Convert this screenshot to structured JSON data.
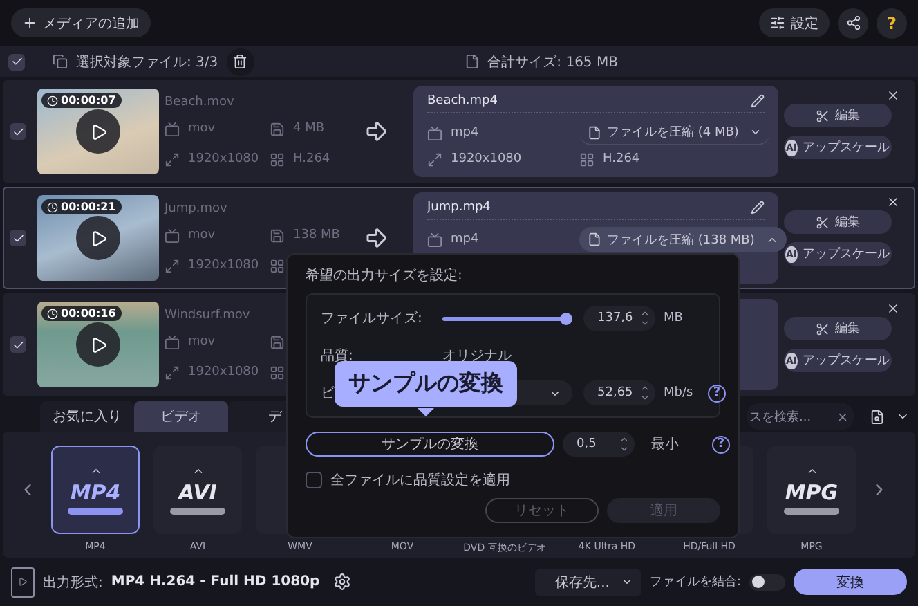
{
  "toolbar": {
    "add_media": "メディアの追加",
    "settings": "設定",
    "help": "?"
  },
  "selection_bar": {
    "checked": true,
    "selected_files": "選択対象ファイル: 3/3",
    "total_size": "合計サイズ: 165 MB"
  },
  "files": [
    {
      "checked": true,
      "selected": false,
      "duration": "00:00:07",
      "source": {
        "name": "Beach.mov",
        "format": "mov",
        "size": "4 MB",
        "resolution": "1920x1080",
        "codec": "H.264"
      },
      "output": {
        "name": "Beach.mp4",
        "format": "mp4",
        "compress": "ファイルを圧縮 (4 MB)",
        "expanded": false,
        "resolution": "1920x1080",
        "codec": "H.264"
      },
      "edit": "編集",
      "ai_badge": "AI",
      "upscale": "アップスケール"
    },
    {
      "checked": true,
      "selected": true,
      "duration": "00:00:21",
      "source": {
        "name": "Jump.mov",
        "format": "mov",
        "size": "138 MB",
        "resolution": "1920x1080"
      },
      "output": {
        "name": "Jump.mp4",
        "format": "mp4",
        "compress": "ファイルを圧縮 (138 MB)",
        "expanded": true
      },
      "edit": "編集",
      "ai_badge": "AI",
      "upscale": "アップスケール"
    },
    {
      "checked": true,
      "selected": false,
      "duration": "00:00:16",
      "source": {
        "name": "Windsurf.mov",
        "format": "mov",
        "resolution": "1920x1080"
      },
      "edit": "編集",
      "ai_badge": "AI",
      "upscale": "アップスケール"
    }
  ],
  "formats": {
    "tabs": [
      {
        "label": "お気に入り",
        "selected": false
      },
      {
        "label": "ビデオ",
        "selected": true
      },
      {
        "label": "デ",
        "selected": false
      }
    ],
    "search": {
      "placeholder": "スを検索..."
    },
    "tiles": [
      {
        "logo": "MP4",
        "label": "MP4",
        "selected": true
      },
      {
        "logo": "AVI",
        "label": "AVI",
        "selected": false
      },
      {
        "label": "WMV",
        "selected": false
      },
      {
        "label": "MOV"
      },
      {
        "label": "DVD 互換のビデオ"
      },
      {
        "label": "4K Ultra HD"
      },
      {
        "label": "HD/Full HD",
        "selected": false
      },
      {
        "logo": "MPG",
        "label": "MPG",
        "selected": false
      }
    ]
  },
  "bottom_bar": {
    "output_label": "出力形式:",
    "output_value": "MP4 H.264 - Full HD 1080p",
    "save_to": "保存先...",
    "merge_label": "ファイルを結合:",
    "merge_on": false,
    "convert": "変換"
  },
  "size_popup": {
    "title": "希望の出力サイズを設定:",
    "file_size_label": "ファイルサイズ:",
    "file_size_slider": {
      "level": 0.95
    },
    "file_size_value": "137,6",
    "file_size_unit": "MB",
    "quality_label": "品質:",
    "quality_value": "オリジナル",
    "bitrate_label": "ビ",
    "bitrate_value": "52,65",
    "bitrate_unit": "Mb/s",
    "bitrate_help": "?",
    "sample_button": "サンプルの変換",
    "sample_value": "0,5",
    "sample_unit": "最小",
    "sample_help": "?",
    "apply_all_label": "全ファイルに品質設定を適用",
    "apply_all_checked": false,
    "reset": "リセット",
    "reset_disabled": true,
    "apply": "適用",
    "apply_disabled": true,
    "tooltip": "サンプルの変換"
  }
}
